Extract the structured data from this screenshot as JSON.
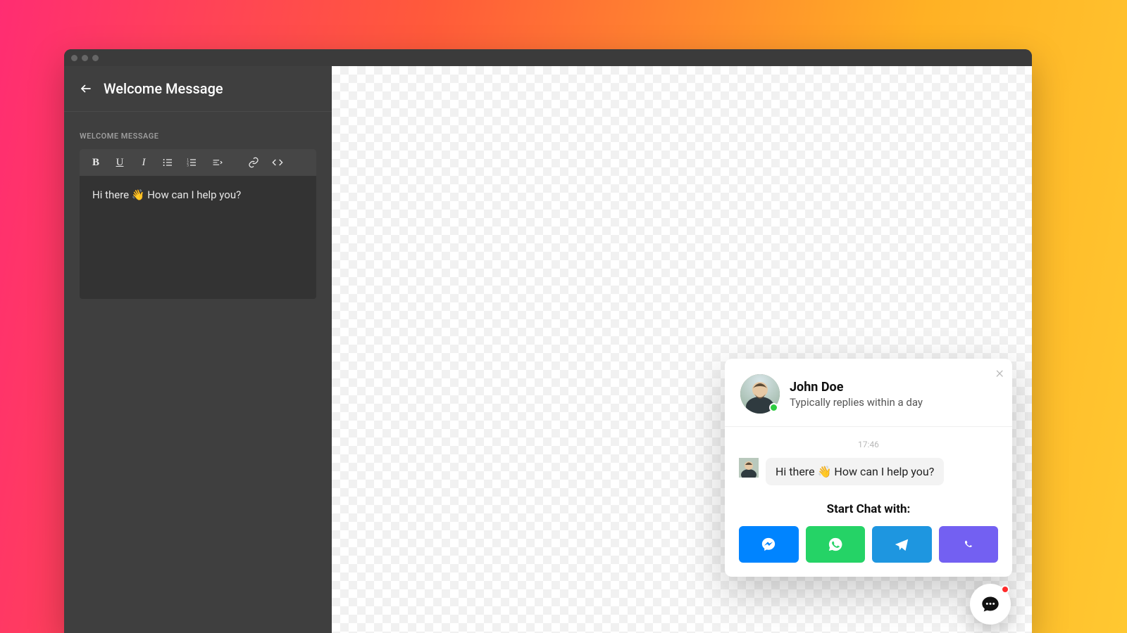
{
  "header": {
    "title": "Welcome Message"
  },
  "section": {
    "label": "WELCOME MESSAGE"
  },
  "editor": {
    "content": "Hi there 👋 How can I help you?"
  },
  "chat": {
    "agent_name": "John Doe",
    "reply_time": "Typically replies within a day",
    "timestamp": "17:46",
    "message": "Hi there 👋 How can I help you?",
    "start_label": "Start Chat with:",
    "channels": {
      "messenger": {
        "color": "#0084ff"
      },
      "whatsapp": {
        "color": "#25d366"
      },
      "telegram": {
        "color": "#1e96e0"
      },
      "viber": {
        "color": "#7360f2"
      }
    }
  },
  "presence": {
    "online": true
  }
}
